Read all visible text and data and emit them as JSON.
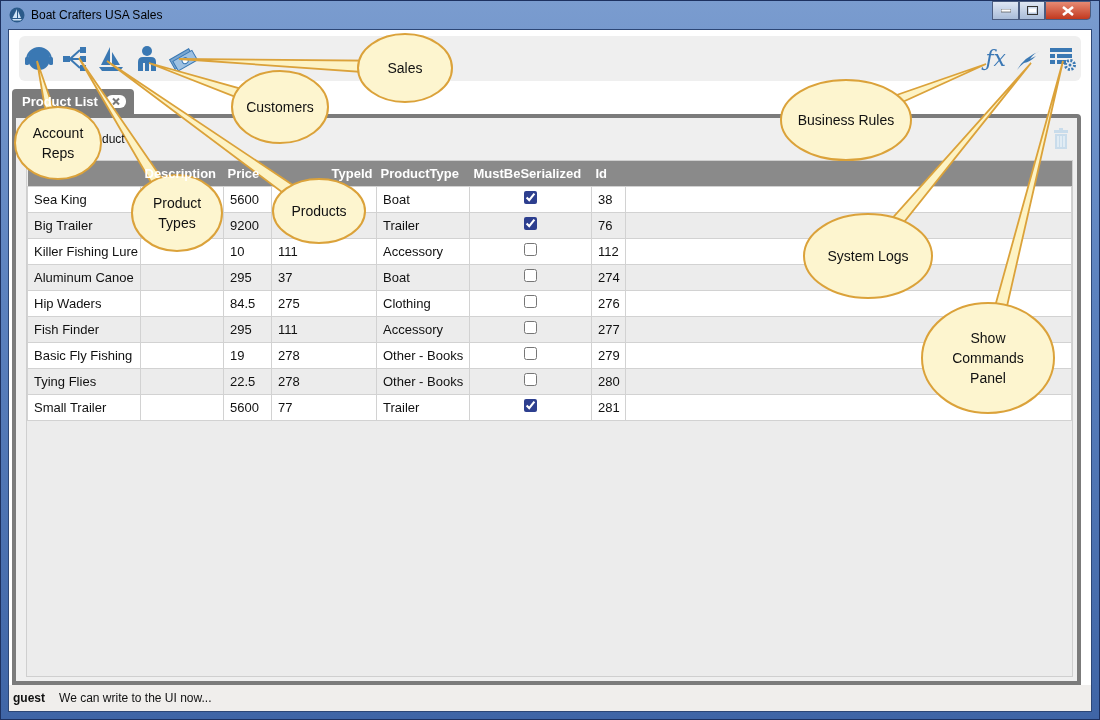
{
  "window": {
    "title": "Boat Crafters USA Sales"
  },
  "tab": {
    "label": "Product List"
  },
  "command": {
    "label": "duct"
  },
  "table": {
    "columns": [
      "Description",
      "Price",
      "TypeId",
      "ProductType",
      "MustBeSerialized",
      "Id"
    ],
    "rows": [
      {
        "name": "Sea King",
        "price": "5600",
        "type": "Boat",
        "serialized": true,
        "id": "38"
      },
      {
        "name": "Big Trailer",
        "price": "9200",
        "type": "Trailer",
        "serialized": true,
        "id": "76"
      },
      {
        "name": "Killer Fishing Lure",
        "price": "10",
        "type_id": "111",
        "type": "Accessory",
        "serialized": false,
        "id": "112"
      },
      {
        "name": "Aluminum Canoe",
        "price": "295",
        "type_id": "37",
        "type": "Boat",
        "serialized": false,
        "id": "274"
      },
      {
        "name": "Hip Waders",
        "price": "84.5",
        "type_id": "275",
        "type": "Clothing",
        "serialized": false,
        "id": "276"
      },
      {
        "name": "Fish Finder",
        "price": "295",
        "type_id": "111",
        "type": "Accessory",
        "serialized": false,
        "id": "277"
      },
      {
        "name": "Basic Fly Fishing",
        "price": "19",
        "type_id": "278",
        "type": "Other - Books",
        "serialized": false,
        "id": "279"
      },
      {
        "name": "Tying Flies",
        "price": "22.5",
        "type_id": "278",
        "type": "Other - Books",
        "serialized": false,
        "id": "280"
      },
      {
        "name": "Small Trailer",
        "price": "5600",
        "type_id": "77",
        "type": "Trailer",
        "serialized": true,
        "id": "281"
      }
    ]
  },
  "toolbar": {
    "formula_glyph": "ƒx"
  },
  "status_bar": {
    "user": "guest",
    "message": "We can write to the UI now..."
  },
  "callouts": [
    {
      "label": "Sales"
    },
    {
      "label": "Customers"
    },
    {
      "label": "Account Reps"
    },
    {
      "label": "Product Types"
    },
    {
      "label": "Products"
    },
    {
      "label": "Business Rules"
    },
    {
      "label": "System Logs"
    },
    {
      "label": "Show Commands Panel"
    }
  ]
}
